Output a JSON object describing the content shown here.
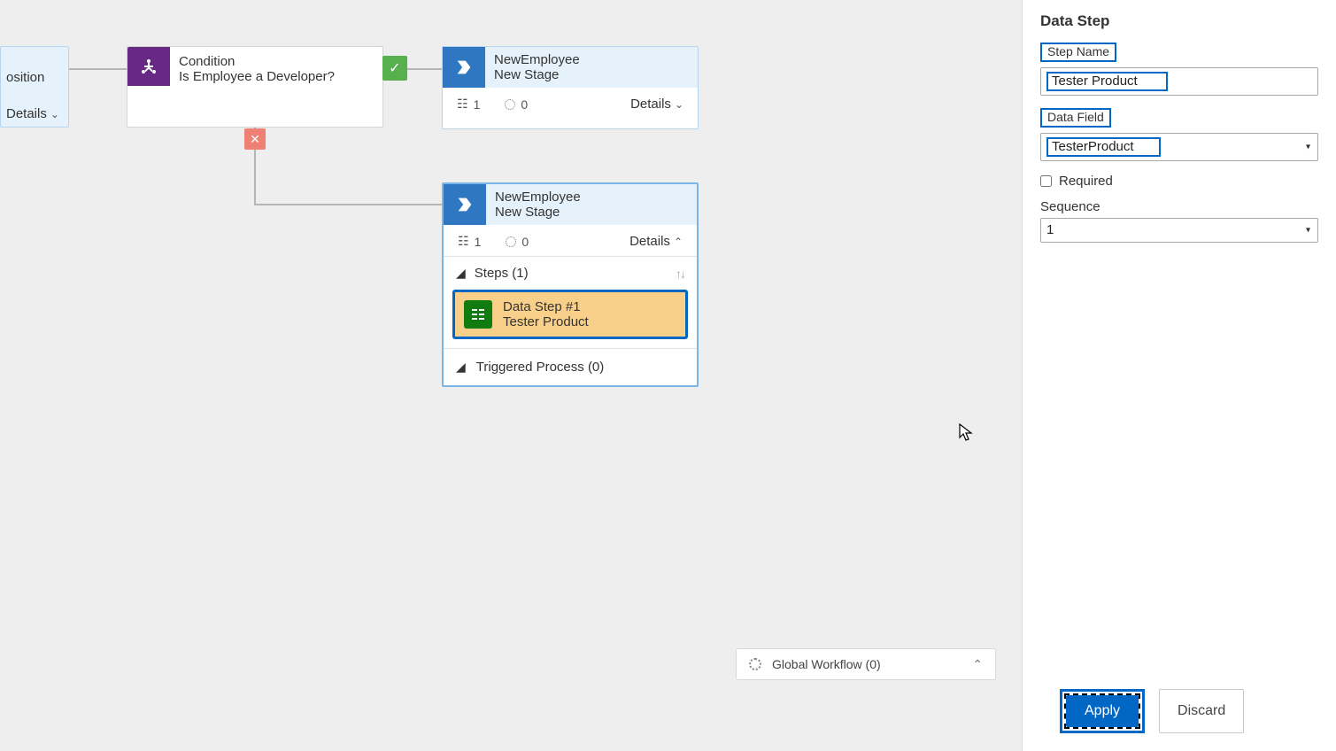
{
  "canvas": {
    "position_node": {
      "label": "osition",
      "details": "Details"
    },
    "condition": {
      "title": "Condition",
      "question": "Is Employee a Developer?"
    },
    "stage1": {
      "entity": "NewEmployee",
      "name": "New Stage",
      "count1": "1",
      "count2": "0",
      "details": "Details"
    },
    "stage2": {
      "entity": "NewEmployee",
      "name": "New Stage",
      "count1": "1",
      "count2": "0",
      "details": "Details",
      "steps_header": "Steps (1)",
      "data_step_title": "Data Step #1",
      "data_step_sub": "Tester Product",
      "triggered": "Triggered Process (0)"
    }
  },
  "global_workflow": "Global Workflow (0)",
  "panel": {
    "title": "Data Step",
    "step_name_label": "Step Name",
    "step_name_value": "Tester Product",
    "data_field_label": "Data Field",
    "data_field_value": "TesterProduct",
    "required_label": "Required",
    "sequence_label": "Sequence",
    "sequence_value": "1",
    "apply": "Apply",
    "discard": "Discard"
  }
}
